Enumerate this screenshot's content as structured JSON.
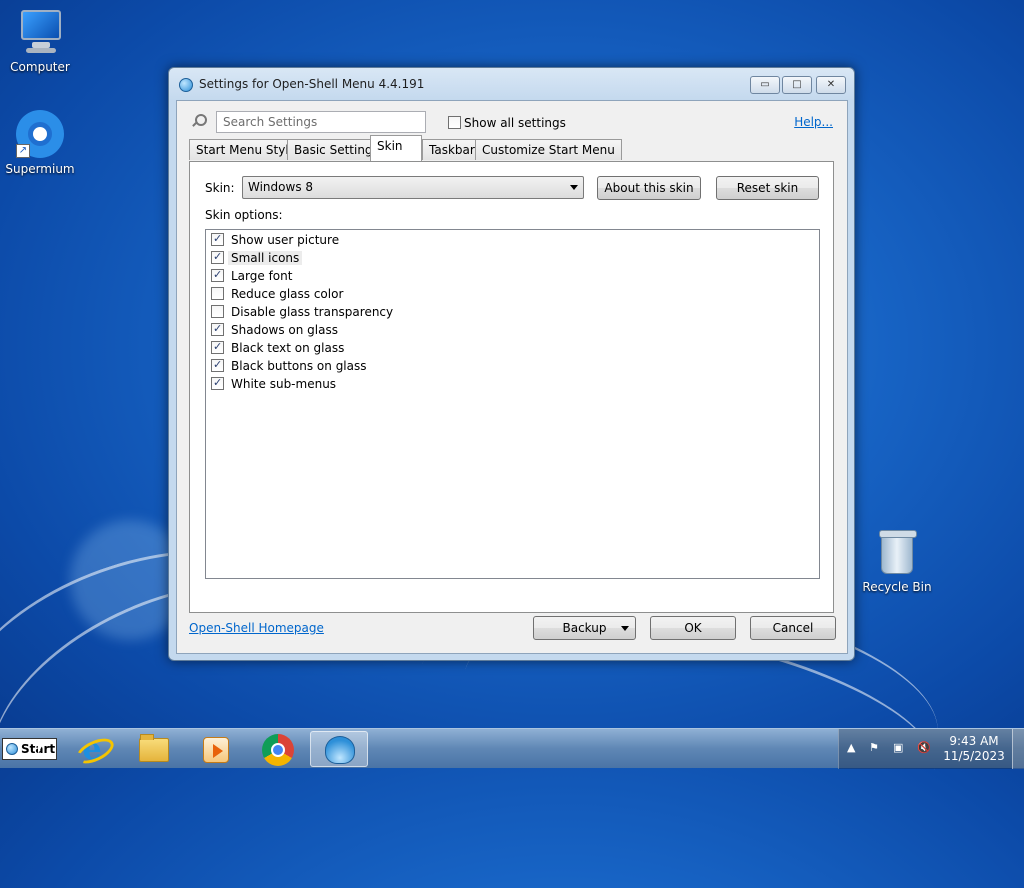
{
  "desktop": {
    "icons": [
      {
        "label": "Computer"
      },
      {
        "label": "Supermium"
      },
      {
        "label": "Recycle Bin"
      }
    ]
  },
  "window": {
    "title": "Settings for Open-Shell Menu 4.4.191",
    "caption_buttons": {
      "minimize": "▭",
      "maximize": "□",
      "close": "✕"
    },
    "search": {
      "placeholder": "Search Settings"
    },
    "show_all": {
      "label": "Show all settings",
      "checked": false
    },
    "help_link": "Help...",
    "tabs": [
      {
        "label": "Start Menu Style",
        "active": false
      },
      {
        "label": "Basic Settings",
        "active": false
      },
      {
        "label": "Skin",
        "active": true
      },
      {
        "label": "Taskbar",
        "active": false
      },
      {
        "label": "Customize Start Menu",
        "active": false
      }
    ],
    "skin": {
      "label": "Skin:",
      "selected": "Windows 8",
      "about_button": "About this skin",
      "reset_button": "Reset skin"
    },
    "skin_options_label": "Skin options:",
    "skin_options": [
      {
        "label": "Show user picture",
        "checked": true
      },
      {
        "label": "Small icons",
        "checked": true
      },
      {
        "label": "Large font",
        "checked": true
      },
      {
        "label": "Reduce glass color",
        "checked": false
      },
      {
        "label": "Disable glass transparency",
        "checked": false
      },
      {
        "label": "Shadows on glass",
        "checked": true
      },
      {
        "label": "Black text on glass",
        "checked": true
      },
      {
        "label": "Black buttons on glass",
        "checked": true
      },
      {
        "label": "White sub-menus",
        "checked": true
      }
    ],
    "footer": {
      "homepage_link": "Open-Shell Homepage",
      "backup_button": "Backup",
      "ok_button": "OK",
      "cancel_button": "Cancel"
    }
  },
  "taskbar": {
    "start_label": "Start",
    "apps": [
      "internet-explorer-icon",
      "file-explorer-icon",
      "media-player-icon",
      "chrome-icon",
      "open-shell-icon"
    ],
    "tray": {
      "time": "9:43 AM",
      "date": "11/5/2023"
    }
  }
}
